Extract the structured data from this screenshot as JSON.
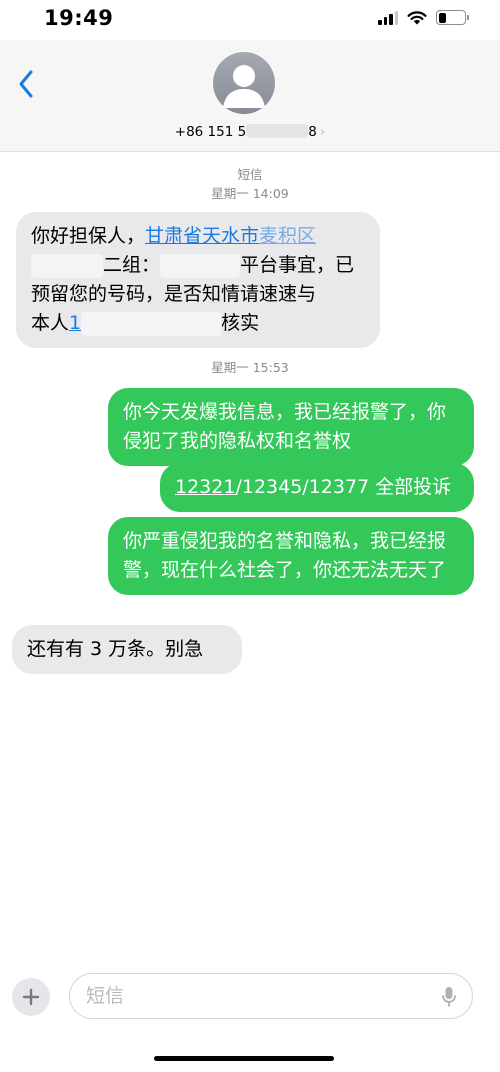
{
  "status_bar": {
    "time": "19:49"
  },
  "header": {
    "contact": "+86 151 5",
    "contact_masked": "8"
  },
  "thread": {
    "service_label": "短信",
    "timestamp_1": "星期一 14:09",
    "timestamp_2": "星期一 15:53"
  },
  "messages": {
    "m1": {
      "part1": "你好担保人，",
      "link1": "甘肃省天水市",
      "link1_tail": "麦积区",
      "part2": "二组：",
      "part3": "平台事宜，已",
      "line3": "预留您的号码，是否知情请速速与",
      "part4": "本人",
      "link2": "1",
      "part5": "核实"
    },
    "m2": {
      "text": "你今天发爆我信息，我已经报警了，你侵犯了我的隐私权和名誉权"
    },
    "m3": {
      "link": "12321",
      "rest": "/12345/12377 全部投诉"
    },
    "m4": {
      "text": "你严重侵犯我的名誉和隐私，我已经报警，现在什么社会了，你还无法无天了"
    },
    "m5": {
      "text": "还有有 3 万条。别急"
    }
  },
  "compose": {
    "placeholder": "短信"
  },
  "colors": {
    "incoming_bubble": "#e9e9eb",
    "outgoing_bubble": "#34c759",
    "ios_blue": "#1a7ae0",
    "meta_gray": "#8a8a8e"
  },
  "icons": {
    "back": "chevron-left-icon",
    "avatar": "person-silhouette-icon",
    "plus": "plus-icon",
    "mic": "microphone-icon",
    "signal": "cellular-signal-icon",
    "wifi": "wifi-icon",
    "battery": "battery-icon"
  }
}
